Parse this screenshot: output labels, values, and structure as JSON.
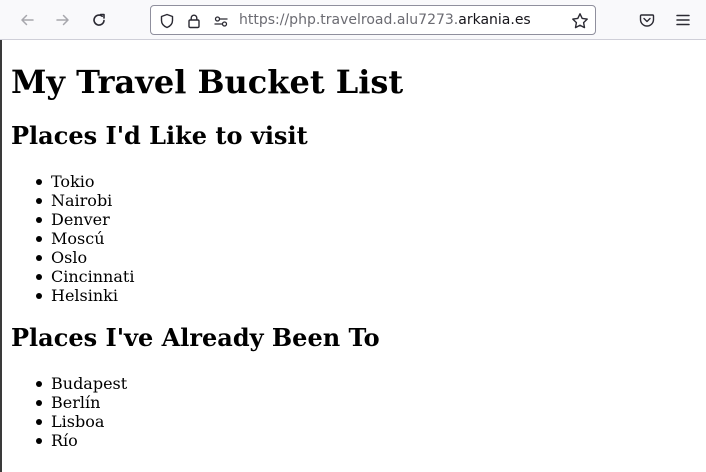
{
  "browser": {
    "url_prefix": "https://php.travelroad.alu7273.",
    "url_host": "arkania.es"
  },
  "page": {
    "title": "My Travel Bucket List",
    "wishlist_heading": "Places I'd Like to visit",
    "wishlist": [
      "Tokio",
      "Nairobi",
      "Denver",
      "Moscú",
      "Oslo",
      "Cincinnati",
      "Helsinki"
    ],
    "visited_heading": "Places I've Already Been To",
    "visited": [
      "Budapest",
      "Berlín",
      "Lisboa",
      "Río"
    ]
  }
}
